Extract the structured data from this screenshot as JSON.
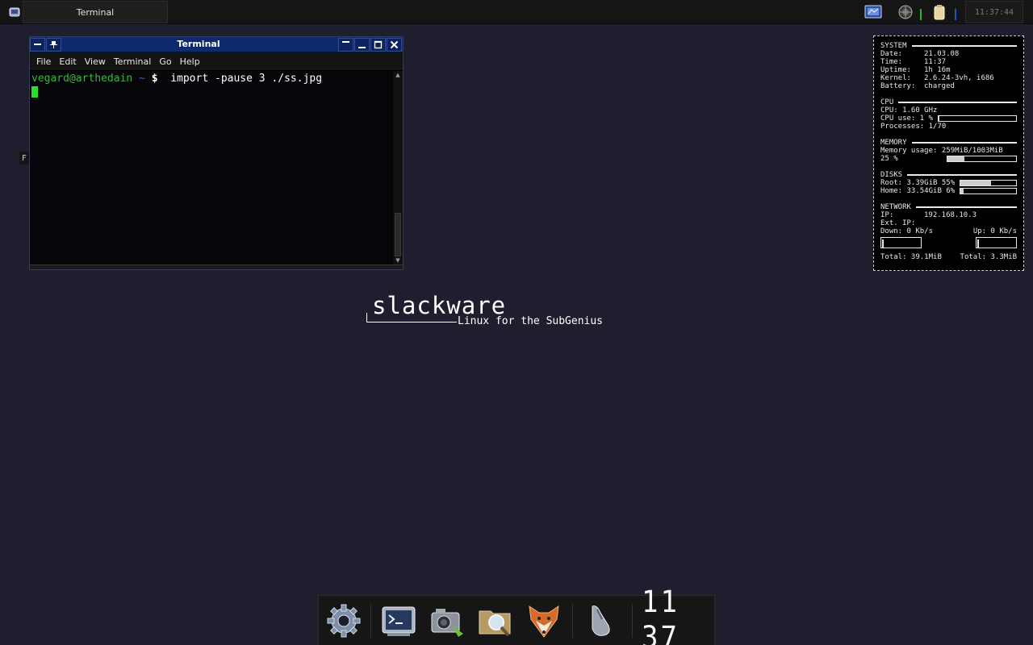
{
  "panel": {
    "menu_icon": "slackware-menu-icon",
    "taskbar_entry": "Terminal",
    "tray_icons": [
      "display-settings-icon",
      "network-icon",
      "battery-icon"
    ],
    "clock": "11:37:44"
  },
  "terminal": {
    "title": "Terminal",
    "menu": [
      "File",
      "Edit",
      "View",
      "Terminal",
      "Go",
      "Help"
    ],
    "prompt_user": "vegard@arthedain",
    "prompt_dir": "~",
    "prompt_symbol": "$",
    "command": "import -pause 3 ./ss.jpg"
  },
  "left_edge_tag": "F",
  "conky": {
    "system": {
      "heading": "SYSTEM",
      "date_label": "Date:",
      "date": "21.03.08",
      "time_label": "Time:",
      "time": "11:37",
      "uptime_label": "Uptime:",
      "uptime": "1h 16m",
      "kernel_label": "Kernel:",
      "kernel": "2.6.24-3vh, i686",
      "battery_label": "Battery:",
      "battery": "charged"
    },
    "cpu": {
      "heading": "CPU",
      "freq_text": "CPU: 1.60 GHz",
      "use_text": "CPU use: 1 %",
      "use_fraction": 0.01,
      "processes_text": "Processes: 1/70"
    },
    "memory": {
      "heading": "MEMORY",
      "usage_text": "Memory usage: 259MiB/1003MiB",
      "percent_text": "25 %",
      "fraction": 0.25
    },
    "disks": {
      "heading": "DISKS",
      "root_text": "Root: 3.39GiB 55%",
      "root_fraction": 0.55,
      "home_text": "Home: 33.54GiB 6%",
      "home_fraction": 0.06
    },
    "network": {
      "heading": "NETWORK",
      "ip_label": "IP:",
      "ip": "192.168.10.3",
      "ext_ip_label": "Ext. IP:",
      "ext_ip": "",
      "down_text": "Down: 0 Kb/s",
      "up_text": "Up: 0 Kb/s",
      "total_down": "Total: 39.1MiB",
      "total_up": "Total: 3.3MiB"
    }
  },
  "wallpaper": {
    "logo": "slackware",
    "tagline": "Linux for the SubGenius"
  },
  "dock": {
    "items": [
      "settings-gear-icon",
      "terminal-icon",
      "screenshot-camera-icon",
      "file-search-icon",
      "firefox-icon",
      "mouse-icon"
    ],
    "clock": "11 37"
  }
}
